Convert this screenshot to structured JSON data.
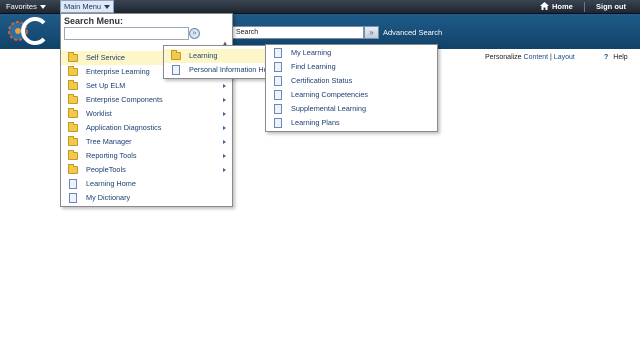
{
  "topbar": {
    "favorites_label": "Favorites",
    "main_menu_label": "Main Menu",
    "home_label": "Home",
    "signout_label": "Sign out"
  },
  "header": {
    "search_value": "Search",
    "advanced_search_label": "Advanced Search",
    "brand_color": "#1f5c8a"
  },
  "page_links": {
    "personalize": "Personalize",
    "content": "Content",
    "separator": "|",
    "layout": "Layout",
    "help": "Help"
  },
  "main_menu": {
    "title": "Search Menu:",
    "search_value": "",
    "items": [
      {
        "label": "Self Service",
        "icon": "folder-icon",
        "submenu": true,
        "selected": true
      },
      {
        "label": "Enterprise Learning",
        "icon": "folder-icon",
        "submenu": true
      },
      {
        "label": "Set Up ELM",
        "icon": "folder-icon",
        "submenu": true
      },
      {
        "label": "Enterprise Components",
        "icon": "folder-icon",
        "submenu": true
      },
      {
        "label": "Worklist",
        "icon": "folder-icon",
        "submenu": true
      },
      {
        "label": "Application Diagnostics",
        "icon": "folder-icon",
        "submenu": true
      },
      {
        "label": "Tree Manager",
        "icon": "folder-icon",
        "submenu": true
      },
      {
        "label": "Reporting Tools",
        "icon": "folder-icon",
        "submenu": true
      },
      {
        "label": "PeopleTools",
        "icon": "folder-icon",
        "submenu": true
      },
      {
        "label": "Learning Home",
        "icon": "document-icon",
        "submenu": false
      },
      {
        "label": "My Dictionary",
        "icon": "document-icon",
        "submenu": false
      }
    ]
  },
  "self_service_menu": {
    "items": [
      {
        "label": "Learning",
        "icon": "folder-icon",
        "selected": true
      },
      {
        "label": "Personal Information Ho",
        "icon": "document-icon"
      }
    ]
  },
  "learning_menu": {
    "items": [
      {
        "label": "My Learning",
        "icon": "document-icon"
      },
      {
        "label": "Find Learning",
        "icon": "document-icon"
      },
      {
        "label": "Certification Status",
        "icon": "document-icon"
      },
      {
        "label": "Learning Competencies",
        "icon": "document-icon"
      },
      {
        "label": "Supplemental Learning",
        "icon": "document-icon"
      },
      {
        "label": "Learning Plans",
        "icon": "document-icon"
      }
    ]
  }
}
